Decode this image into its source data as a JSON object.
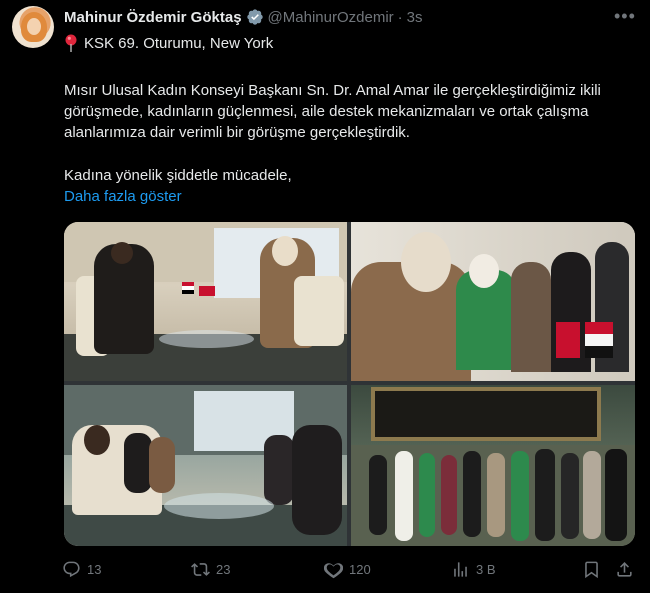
{
  "author": {
    "name": "Mahinur Özdemir Göktaş",
    "handle": "@MahinurOzdemir",
    "separator": "·",
    "time": "3s"
  },
  "location_line": "KSK 69. Oturumu, New York",
  "body": "Mısır Ulusal Kadın Konseyi Başkanı Sn. Dr. Amal Amar ile gerçekleştirdiğimiz ikili görüşmede, kadınların güçlenmesi, aile destek mekanizmaları ve ortak çalışma alanlarımıza dair verimli bir görüşme gerçekleştirdik.",
  "body_line2": "Kadına yönelik şiddetle mücadele,",
  "show_more": "Daha fazla göster",
  "stats": {
    "replies": "13",
    "reposts": "23",
    "likes": "120",
    "views": "3 B"
  },
  "icons": {
    "verified": "verified-badge-icon",
    "pin": "round-pushpin-icon",
    "more": "more-dots-icon",
    "reply": "reply-icon",
    "repost": "repost-icon",
    "like": "heart-icon",
    "views": "views-icon",
    "bookmark": "bookmark-icon",
    "share": "share-icon"
  },
  "colors": {
    "background": "#000000",
    "text": "#e7e9ea",
    "muted": "#71767b",
    "link": "#1d9bf0"
  }
}
